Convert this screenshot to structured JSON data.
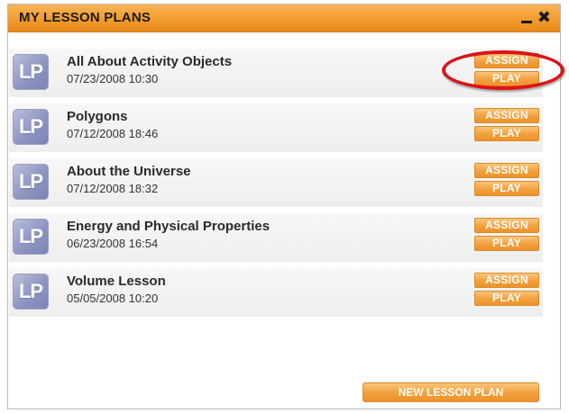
{
  "window": {
    "title": "MY LESSON PLANS",
    "minimize_icon": "minimize-icon",
    "close_icon": "close-icon",
    "close_glyph": "✖"
  },
  "lesson_plans": [
    {
      "icon_text": "LP",
      "name": "All About Activity Objects",
      "date": "07/23/2008 10:30",
      "assign_label": "ASSIGN",
      "play_label": "PLAY"
    },
    {
      "icon_text": "LP",
      "name": "Polygons",
      "date": "07/12/2008 18:46",
      "assign_label": "ASSIGN",
      "play_label": "PLAY"
    },
    {
      "icon_text": "LP",
      "name": "About the Universe",
      "date": "07/12/2008 18:32",
      "assign_label": "ASSIGN",
      "play_label": "PLAY"
    },
    {
      "icon_text": "LP",
      "name": "Energy and Physical Properties",
      "date": "06/23/2008 16:54",
      "assign_label": "ASSIGN",
      "play_label": "PLAY"
    },
    {
      "icon_text": "LP",
      "name": "Volume Lesson",
      "date": "05/05/2008 10:20",
      "assign_label": "ASSIGN",
      "play_label": "PLAY"
    }
  ],
  "footer": {
    "new_lesson_plan_label": "NEW LESSON PLAN"
  },
  "colors": {
    "title_bar": "#f29c2e",
    "button": "#f2a03d",
    "lp_icon": "#8e95c2",
    "highlight": "#dd1414"
  }
}
